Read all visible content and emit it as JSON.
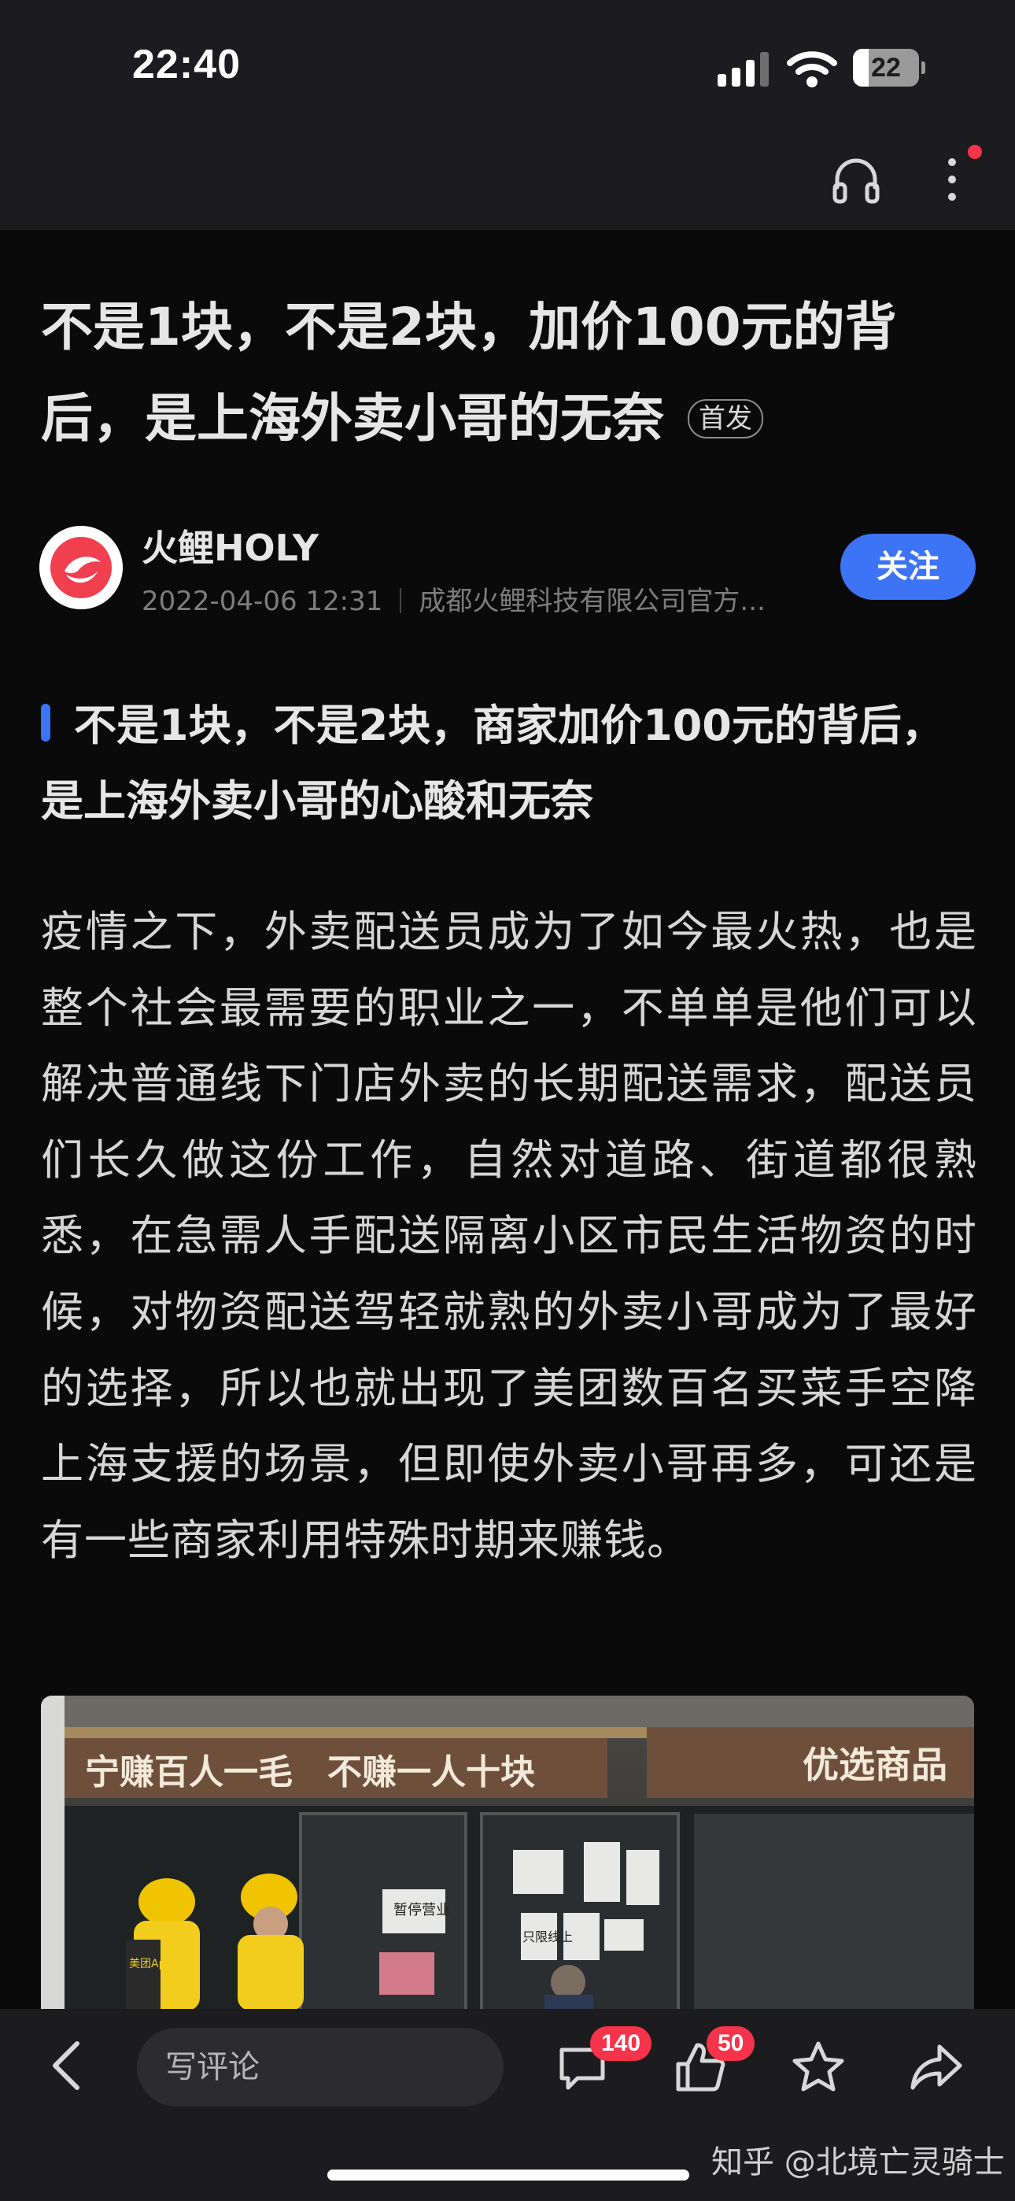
{
  "status_bar": {
    "time": "22:40",
    "battery": "22"
  },
  "article": {
    "title": "不是1块，不是2块，加价100元的背后，是上海外卖小哥的无奈",
    "badge": "首发",
    "author": {
      "name": "火鲤HOLY",
      "date": "2022-04-06 12:31",
      "org": "成都火鲤科技有限公司官方..."
    },
    "follow_label": "关注",
    "subheading": "不是1块，不是2块，商家加价100元的背后，是上海外卖小哥的心酸和无奈",
    "paragraph": "疫情之下，外卖配送员成为了如今最火热，也是整个社会最需要的职业之一，不单单是他们可以解决普通线下门店外卖的长期配送需求，配送员们长久做这份工作，自然对道路、街道都很熟悉，在急需人手配送隔离小区市民生活物资的时候，对物资配送驾轻就熟的外卖小哥成为了最好的选择，所以也就出现了美团数百名买菜手空降上海支援的场景，但即使外卖小哥再多，可还是有一些商家利用特殊时期来赚钱。",
    "photo": {
      "sign_left": "宁赚百人一毛　不赚一人十块",
      "sign_right": "优选商品",
      "notice_1": "暂停营业",
      "notice_2": "只限线上",
      "bag_text": "美团",
      "vest_text": "美团App"
    }
  },
  "bottom_bar": {
    "comment_placeholder": "写评论",
    "comment_count": "140",
    "like_count": "50",
    "watermark": "知乎 @北境亡灵骑士"
  },
  "colors": {
    "accent": "#3d73f5",
    "badge_red": "#f5334a",
    "avatar_red": "#f0404f"
  }
}
